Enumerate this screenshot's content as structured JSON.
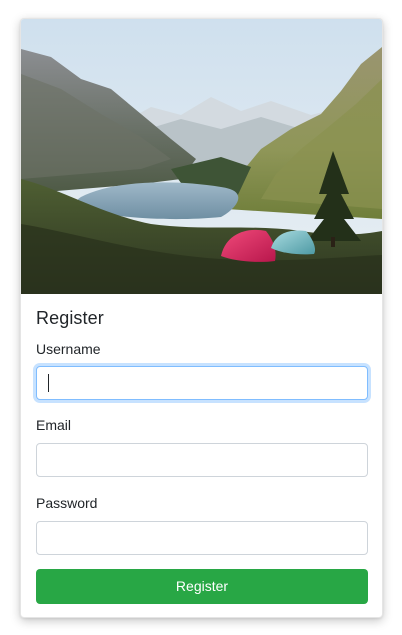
{
  "form": {
    "title": "Register",
    "username_label": "Username",
    "username_value": "",
    "email_label": "Email",
    "email_value": "",
    "password_label": "Password",
    "password_value": "",
    "submit_label": "Register"
  },
  "hero": {
    "subject": "mountain lake valley with two tents on a grassy hillside"
  },
  "colors": {
    "primary_button": "#28a745",
    "focus_border": "#80bdff",
    "input_border": "#ced4da"
  }
}
